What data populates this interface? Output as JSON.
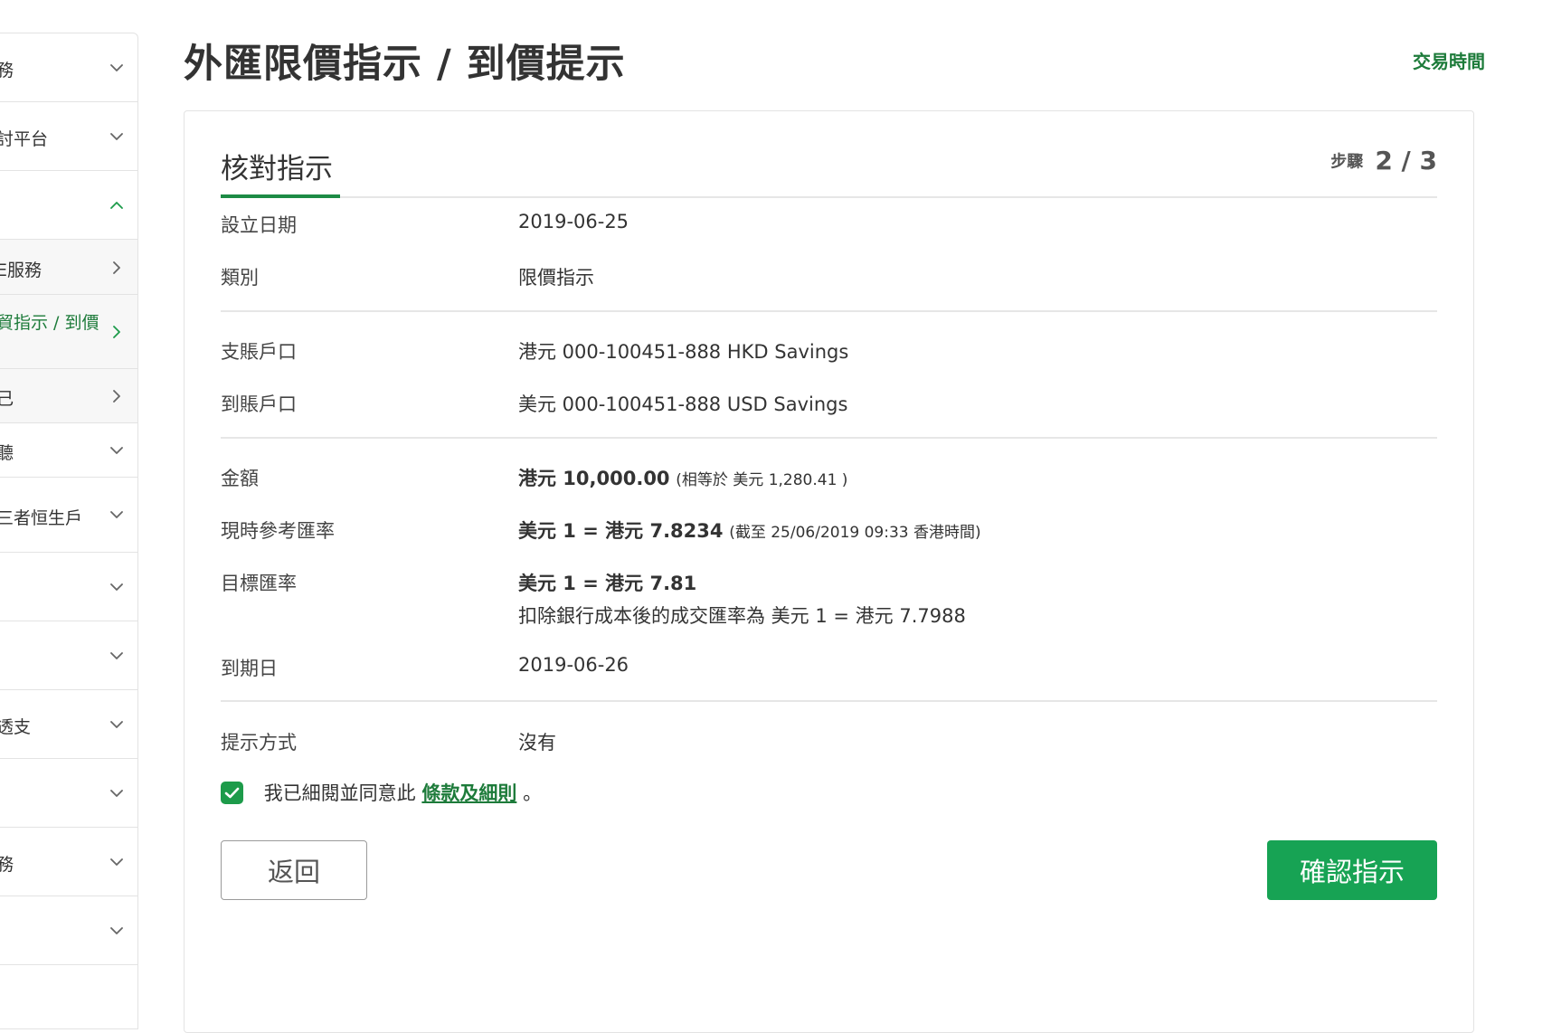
{
  "sidebar": {
    "items": [
      {
        "label": "務",
        "chevron": "down"
      },
      {
        "label": "討平台",
        "chevron": "down"
      },
      {
        "label": "",
        "chevron": "up",
        "active": true
      },
      {
        "label": "E服務",
        "chevron": "right",
        "sub": true
      },
      {
        "label": "貿指示 / 到價",
        "chevron": "right",
        "sub": true,
        "current": true
      },
      {
        "label": "己",
        "chevron": "right",
        "sub": true
      },
      {
        "label": "聽",
        "chevron": "down"
      },
      {
        "label": "三者恒生戶",
        "chevron": "down"
      },
      {
        "label": "",
        "chevron": "down"
      },
      {
        "label": "",
        "chevron": "down"
      },
      {
        "label": "透支",
        "chevron": "down"
      },
      {
        "label": "",
        "chevron": "down"
      },
      {
        "label": "務",
        "chevron": "down"
      },
      {
        "label": "",
        "chevron": "down"
      }
    ]
  },
  "header": {
    "title": "外匯限價指示 / 到價提示",
    "trading_hours": "交易時間"
  },
  "card": {
    "title": "核對指示",
    "step_label": "步驟",
    "step_value": "2 / 3"
  },
  "details": {
    "setup_date": {
      "label": "設立日期",
      "value": "2019-06-25"
    },
    "type": {
      "label": "類別",
      "value": "限價指示"
    },
    "debit_account": {
      "label": "支賬戶口",
      "value": "港元 000-100451-888 HKD Savings"
    },
    "credit_account": {
      "label": "到賬戶口",
      "value": "美元 000-100451-888 USD Savings"
    },
    "amount": {
      "label": "金額",
      "value": "港元 10,000.00",
      "note": "(相等於 美元 1,280.41 )"
    },
    "current_rate": {
      "label": "現時參考匯率",
      "value": "美元 1 = 港元 7.8234",
      "note": "(截至 25/06/2019 09:33 香港時間)"
    },
    "target_rate": {
      "label": "目標匯率",
      "value": "美元 1 = 港元 7.81",
      "note": "扣除銀行成本後的成交匯率為 美元 1 = 港元 7.7988"
    },
    "expiry_date": {
      "label": "到期日",
      "value": "2019-06-26"
    },
    "alert_method": {
      "label": "提示方式",
      "value": "沒有"
    }
  },
  "agreement": {
    "text": "我已細閱並同意此",
    "link": "條款及細則",
    "suffix": "。",
    "checked": true
  },
  "buttons": {
    "back": "返回",
    "confirm": "確認指示"
  },
  "colors": {
    "brand_green": "#17a354",
    "link_green": "#1d7b3a"
  }
}
